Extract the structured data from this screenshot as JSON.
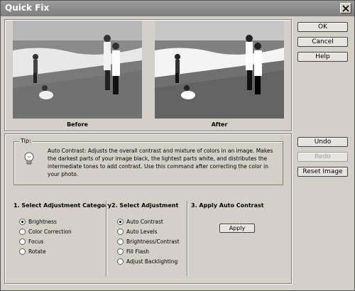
{
  "window": {
    "title": "Quick Fix"
  },
  "preview": {
    "before_label": "Before",
    "after_label": "After"
  },
  "buttons": {
    "ok": "OK",
    "cancel": "Cancel",
    "help": "Help",
    "undo": "Undo",
    "redo": "Redo",
    "reset_image": "Reset Image",
    "apply": "Apply"
  },
  "tip": {
    "legend": "Tip:",
    "text": "Auto Contrast: Adjusts the overall contrast and mixture of colors in an image.  Makes the darkest parts of your  image black, the lightest parts white, and distributes the intermediate tones to  add contrast. Use this command after correcting the color in your  photo."
  },
  "category": {
    "title": "1. Select Adjustment Category",
    "options": [
      "Brightness",
      "Color Correction",
      "Focus",
      "Rotate"
    ],
    "selected": "Brightness"
  },
  "adjustment": {
    "title": "2. Select Adjustment",
    "options": [
      "Auto Contrast",
      "Auto Levels",
      "Brightness/Contrast",
      "Fill Flash",
      "Adjust Backlighting"
    ],
    "selected": "Auto Contrast"
  },
  "apply_section": {
    "title": "3. Apply Auto Contrast"
  }
}
